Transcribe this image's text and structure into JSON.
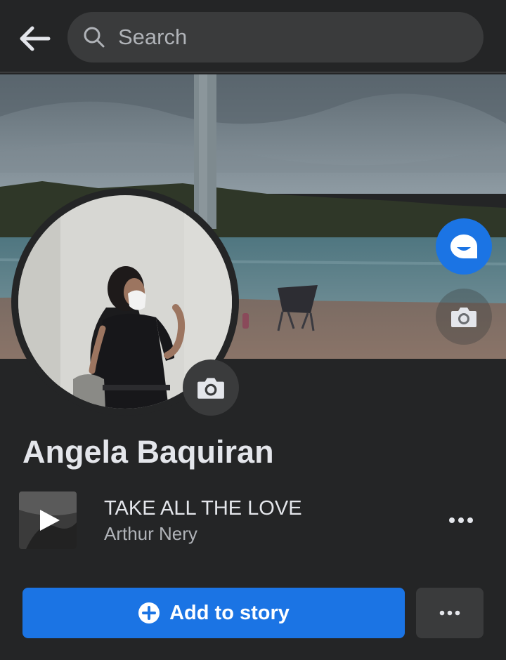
{
  "colors": {
    "background": "#242526",
    "surface": "#3a3b3c",
    "accent": "#1b74e4",
    "primary_text": "#e4e6eb",
    "secondary_text": "#b0b3b8"
  },
  "header": {
    "back_icon": "arrow-left-icon",
    "search": {
      "icon": "search-icon",
      "placeholder": "Search"
    }
  },
  "cover": {
    "action_icon": "avatar-sticker-icon",
    "camera_icon": "camera-icon"
  },
  "profile": {
    "name": "Angela Baquiran",
    "avatar_camera_icon": "camera-icon"
  },
  "music": {
    "title": "TAKE ALL THE LOVE",
    "artist": "Arthur Nery",
    "play_icon": "play-icon",
    "more_icon": "more-horizontal-icon"
  },
  "actions": {
    "add_to_story_label": "Add to story",
    "add_icon": "plus-circle-icon",
    "more_icon": "more-horizontal-icon"
  }
}
